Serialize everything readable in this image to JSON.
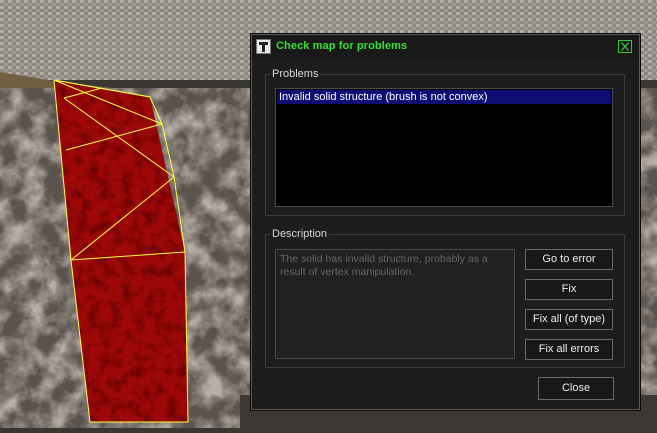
{
  "dialog": {
    "title": "Check map for problems",
    "title_color": "#35e035",
    "problems_label": "Problems",
    "problems": [
      {
        "text": "Invalid solid structure (brush is not convex)",
        "selected": true
      }
    ],
    "description_label": "Description",
    "description_text": "The solid has invalid structure, probably as a result of vertex manipulation.",
    "buttons": {
      "go_to_error": "Go to error",
      "fix": "Fix",
      "fix_all_type": "Fix all (of type)",
      "fix_all_errors": "Fix all errors",
      "close": "Close"
    },
    "icons": {
      "app": "hammer-app-icon",
      "close": "close-icon"
    },
    "colors": {
      "selection": "#0d0d74",
      "highlight": "#ffff44",
      "brush": "#b00a0a"
    }
  }
}
